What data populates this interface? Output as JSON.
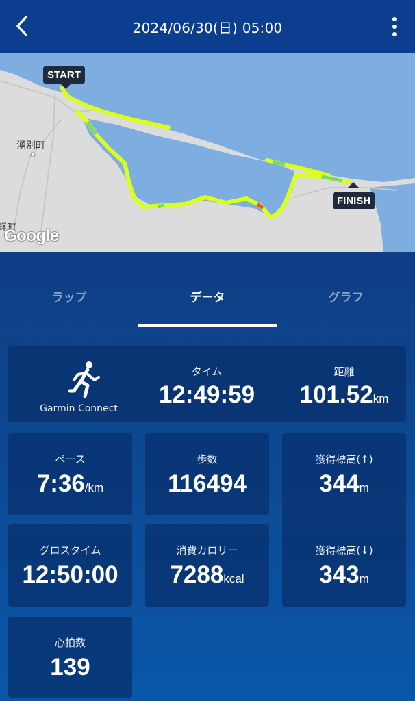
{
  "header": {
    "title": "2024/06/30(日) 05:00",
    "back_icon": "chevron-left-icon",
    "menu_icon": "more-vert-icon"
  },
  "map": {
    "start_label": "START",
    "finish_label": "FINISH",
    "town_label": "湧別町",
    "town_label_partial": "軽町",
    "attribution": "Google",
    "colors": {
      "water": "#7eaedf",
      "land": "#dcdcdc",
      "route": "#d9ff1a"
    }
  },
  "tabs": [
    {
      "label": "ラップ",
      "active": false
    },
    {
      "label": "データ",
      "active": true
    },
    {
      "label": "グラフ",
      "active": false
    }
  ],
  "source": {
    "icon": "runner-icon",
    "label": "Garmin Connect"
  },
  "stats": {
    "time": {
      "label": "タイム",
      "value": "12:49:59"
    },
    "distance": {
      "label": "距離",
      "value": "101.52",
      "unit": "km"
    },
    "pace": {
      "label": "ペース",
      "value": "7:36",
      "unit": "/km"
    },
    "steps": {
      "label": "歩数",
      "value": "116494"
    },
    "elev_gain": {
      "label": "獲得標高(↑)",
      "value": "344",
      "unit": "m"
    },
    "gross_time": {
      "label": "グロスタイム",
      "value": "12:50:00"
    },
    "calories": {
      "label": "消費カロリー",
      "value": "7288",
      "unit": "kcal"
    },
    "elev_loss": {
      "label": "獲得標高(↓)",
      "value": "343",
      "unit": "m"
    },
    "heart_rate": {
      "label": "心拍数",
      "value": "139"
    }
  }
}
